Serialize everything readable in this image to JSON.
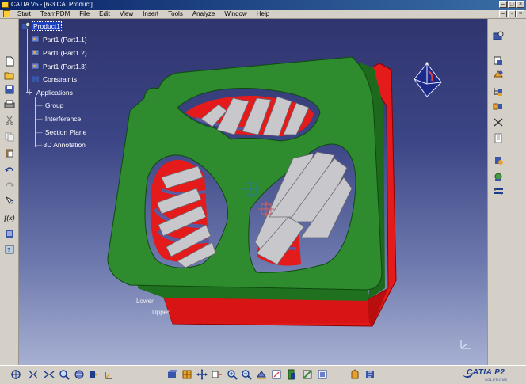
{
  "window": {
    "title": "CATIA V5 - [6-3.CATProduct]"
  },
  "menu": {
    "items": [
      {
        "label": "Start"
      },
      {
        "label": "TeamPDM"
      },
      {
        "label": "File"
      },
      {
        "label": "Edit"
      },
      {
        "label": "View"
      },
      {
        "label": "Insert"
      },
      {
        "label": "Tools"
      },
      {
        "label": "Analyze"
      },
      {
        "label": "Window"
      },
      {
        "label": "Help"
      }
    ]
  },
  "tree": {
    "root": "Product1",
    "parts": [
      "Part1 (Part1.1)",
      "Part1 (Part1.2)",
      "Part1 (Part1.3)"
    ],
    "constraints": "Constraints",
    "applications": "Applications",
    "app_children": [
      "Group",
      "Interference",
      "Section Plane",
      "3D Annotation"
    ]
  },
  "viewport": {
    "labels": {
      "lower": "Lower",
      "upper": "Upper"
    },
    "colors": {
      "frame": "#2e8b2e",
      "base": "#e51a1a",
      "blade": "#c8c8cc",
      "background_top": "#2f356f",
      "background_bottom": "#a7b0d2"
    }
  },
  "branding": {
    "logo": "CATIA P2",
    "sub": "SOLUTIONS"
  },
  "toolbars": {
    "left": [
      "new-icon",
      "open-icon",
      "save-icon",
      "print-icon",
      "cut-icon",
      "copy-icon",
      "paste-icon",
      "undo-icon",
      "redo-icon",
      "what-is-this-icon",
      "formula-icon",
      "catalog-icon",
      "macro-icon"
    ],
    "right": [
      "product-icon",
      "existing-component-icon",
      "replace-component-icon",
      "graph-tree-icon",
      "generate-numbering-icon",
      "fix-icon",
      "reorder-icon",
      "snap-icon",
      "manipulate-icon",
      "explode-icon"
    ],
    "bottom": [
      "fly-mode-icon",
      "fit-all-icon",
      "pan-icon",
      "rotate-icon",
      "zoom-in-icon",
      "zoom-out-icon",
      "normal-view-icon",
      "iso-view-icon",
      "shading-icon",
      "hide-show-icon",
      "swap-icon",
      "measure-icon",
      "clash-icon",
      "section-icon",
      "sectioning-icon",
      "annotation-icon",
      "3d-annotation-icon"
    ]
  }
}
